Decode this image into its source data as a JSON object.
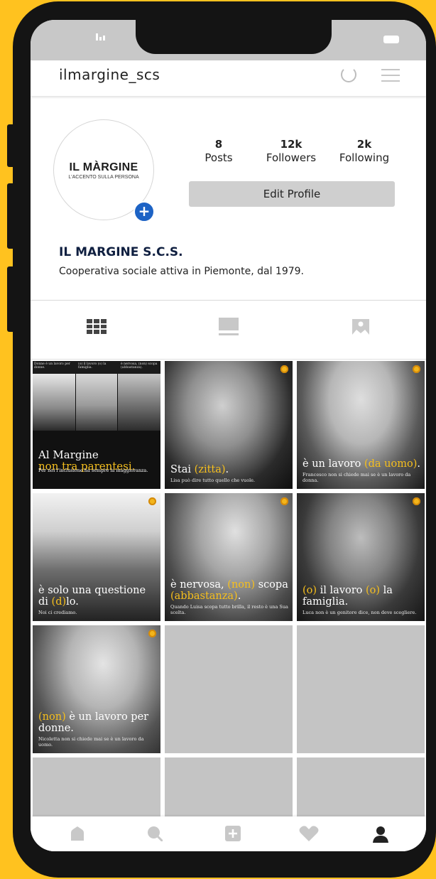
{
  "profile": {
    "username": "ilmargine_scs",
    "logo_text": "IL MÀRGINE",
    "logo_subtext": "L'ACCENTO SULLA PERSONA",
    "display_name": "IL MARGINE S.C.S.",
    "bio": "Cooperativa sociale attiva in Piemonte, dal 1979.",
    "edit_label": "Edit Profile"
  },
  "stats": [
    {
      "value": "8",
      "label": "Posts"
    },
    {
      "value": "12k",
      "label": "Followers"
    },
    {
      "value": "2k",
      "label": "Following"
    }
  ],
  "posts": [
    {
      "title_a": "Al Margine",
      "title_hl": "non tra parentesi.",
      "subtitle": "Per noi l'inclusione ha sempre la maggioranza.",
      "strip": [
        "Donne è un lavoro per donne.",
        "(o) il lavoro (o) la famiglia.",
        "è nervosa, (non) scopa (abbastanza)."
      ]
    },
    {
      "title_a": "Stai ",
      "title_hl": "(zitta)",
      "title_b": ".",
      "subtitle": "Lisa può dire tutto quello che vuole."
    },
    {
      "title_a": "è un lavoro ",
      "title_hl": "(da uomo)",
      "title_b": ".",
      "subtitle": "Francesco non si chiede mai se è un lavoro da donna."
    },
    {
      "title_a": "è solo una questione di ",
      "title_hl": "(d)",
      "title_b": "lo.",
      "subtitle": "Noi ci crediamo."
    },
    {
      "title_a": "è nervosa, ",
      "title_hl": "(non)",
      "title_b": " scopa ",
      "title_hl2": "(abbastanza)",
      "title_c": ".",
      "subtitle": "Quando Luisa scopa tutto brilla, il resto è una Sua scelta."
    },
    {
      "title_hl": "(o)",
      "title_a": " il lavoro ",
      "title_hl2": "(o)",
      "title_b": " la famiglia.",
      "subtitle": "Luca non è un genitore dice, non deve sceglierе."
    },
    {
      "title_hl": "(non)",
      "title_a": " è un lavoro per donne.",
      "subtitle": "Nicoletta non si chiede mai se è un lavoro da uomo."
    }
  ],
  "icons": {
    "grid": "grid-icon",
    "list": "list-icon",
    "tagged": "tagged-icon",
    "home": "home-icon",
    "search": "search-icon",
    "add": "add-icon",
    "heart": "heart-icon",
    "profile": "profile-icon"
  },
  "colors": {
    "accent": "#FFC21F",
    "highlight": "#F6BF1D",
    "add_button": "#1D63C5",
    "name": "#0F1F40"
  }
}
